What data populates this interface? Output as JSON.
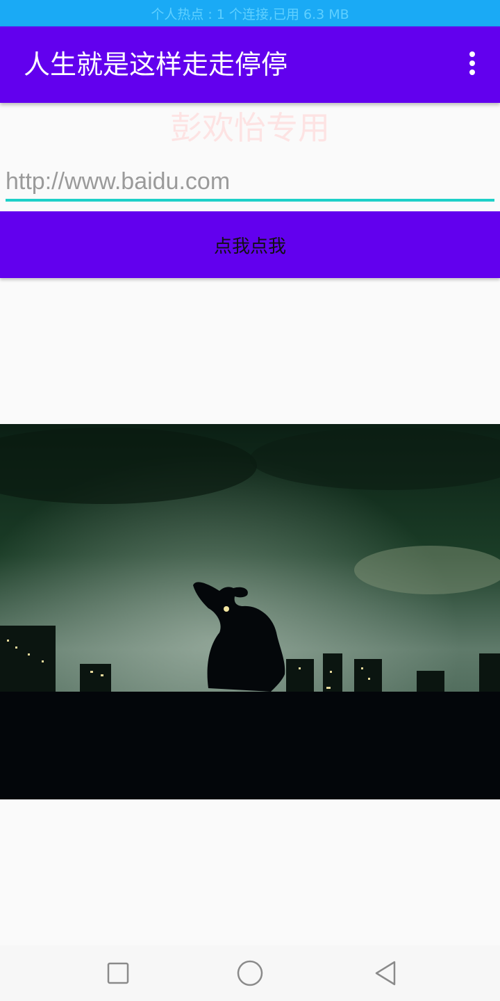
{
  "status_bar": {
    "text": "个人热点 : 1 个连接,已用 6.3 MB"
  },
  "app_bar": {
    "title": "人生就是这样走走停停",
    "overflow_icon": "more-vert-icon"
  },
  "watermark": {
    "text": "彭欢怡专用"
  },
  "url_field": {
    "placeholder": "http://www.baidu.com",
    "value": ""
  },
  "action_button": {
    "label": "点我点我"
  },
  "photo": {
    "subject": ""
  },
  "nav_bar": {
    "recents_icon": "square-icon",
    "home_icon": "circle-icon",
    "back_icon": "triangle-back-icon"
  },
  "colors": {
    "primary": "#6200ee",
    "status": "#1aaaf5",
    "accent": "#1ed0c8",
    "watermark": "#fde3e3"
  }
}
